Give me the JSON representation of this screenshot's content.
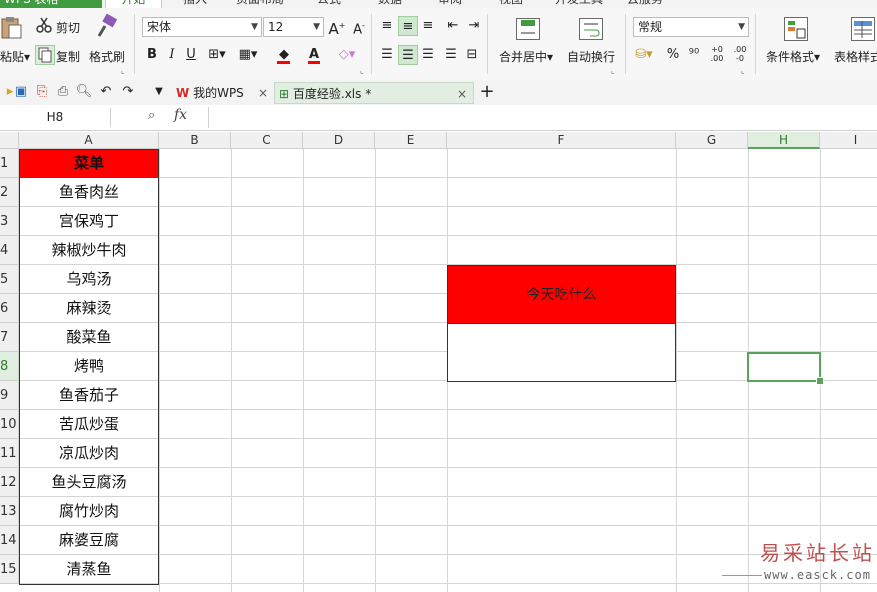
{
  "ribbon_tabs": {
    "app": "WPS 表格",
    "items": [
      "开始",
      "插入",
      "页面布局",
      "公式",
      "数据",
      "审阅",
      "视图",
      "开发工具",
      "云服务"
    ],
    "active": "开始"
  },
  "ribbon": {
    "paste_label": "粘贴",
    "cut_label": "剪切",
    "copy_label": "复制",
    "format_painter_label": "格式刷",
    "font_name": "宋体",
    "font_size": "12",
    "merge_center_label": "合并居中",
    "wrap_text_label": "自动换行",
    "number_format": "常规",
    "conditional_format_label": "条件格式",
    "table_style_label": "表格样式",
    "percent_symbol": "%",
    "bold": "B",
    "italic": "I",
    "underline": "U"
  },
  "doc_tabs": {
    "items": [
      {
        "label": "我的WPS",
        "active": false
      },
      {
        "label": "百度经验.xls *",
        "active": true
      }
    ],
    "add_label": "+"
  },
  "formula_bar": {
    "name_box": "H8",
    "fx_label": "fx",
    "content": ""
  },
  "grid": {
    "columns": [
      "A",
      "B",
      "C",
      "D",
      "E",
      "F",
      "G",
      "H",
      "I"
    ],
    "selected_column": "H",
    "rows": [
      "1",
      "2",
      "3",
      "4",
      "5",
      "6",
      "7",
      "8",
      "9",
      "10",
      "11",
      "12",
      "13",
      "14",
      "15"
    ],
    "selected_row": "8",
    "selected_cell": "H8",
    "menu_header": "菜单",
    "menu_items": [
      "鱼香肉丝",
      "宫保鸡丁",
      "辣椒炒牛肉",
      "乌鸡汤",
      "麻辣烫",
      "酸菜鱼",
      "烤鸭",
      "鱼香茄子",
      "苦瓜炒蛋",
      "凉瓜炒肉",
      "鱼头豆腐汤",
      "腐竹炒肉",
      "麻婆豆腐",
      "清蒸鱼"
    ],
    "f_merged_label": "今天吃什么",
    "f_result": ""
  },
  "colors": {
    "header_red": "#ff0000",
    "selection_green": "#5aa35a",
    "wps_green": "#3f9c3f"
  },
  "watermark": {
    "title": "易采站长站",
    "url": "www.easck.com"
  }
}
